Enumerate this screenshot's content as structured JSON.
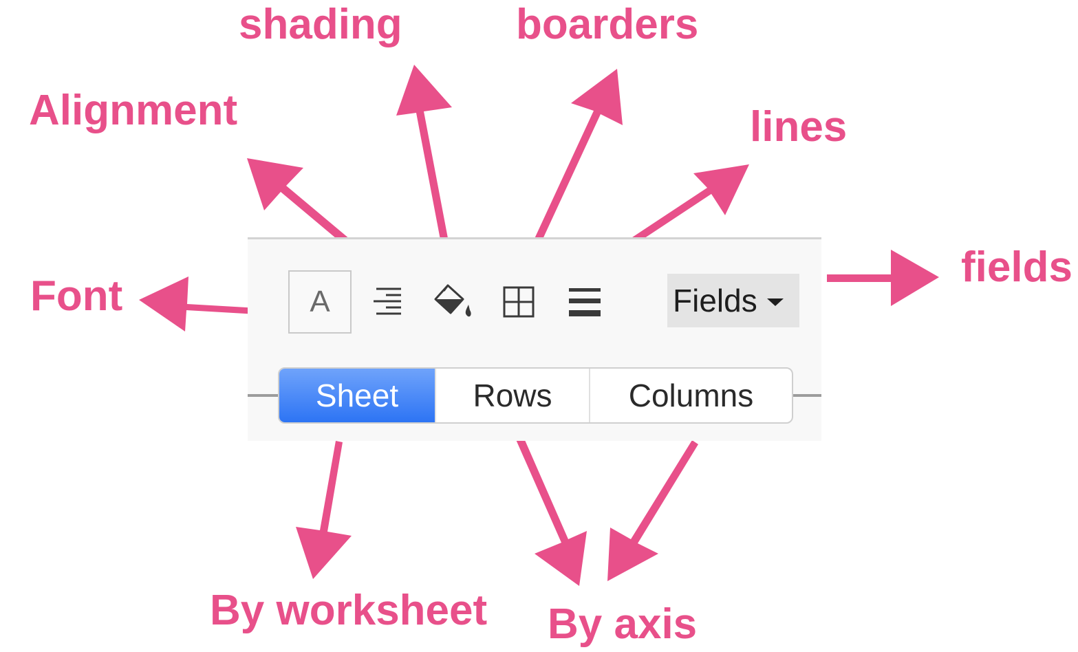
{
  "accent_color": "#e8508a",
  "annotations": {
    "shading": "shading",
    "boarders": "boarders",
    "alignment": "Alignment",
    "lines": "lines",
    "font": "Font",
    "fields": "fields",
    "by_worksheet": "By worksheet",
    "by_axis": "By axis"
  },
  "toolbar": {
    "font_label": "A",
    "fields_label": "Fields",
    "icons": [
      "font-icon",
      "align-right-icon",
      "paint-bucket-icon",
      "borders-grid-icon",
      "lines-icon",
      "caret-down-icon"
    ]
  },
  "segmented": {
    "selected": "Sheet",
    "items": [
      "Sheet",
      "Rows",
      "Columns"
    ]
  }
}
